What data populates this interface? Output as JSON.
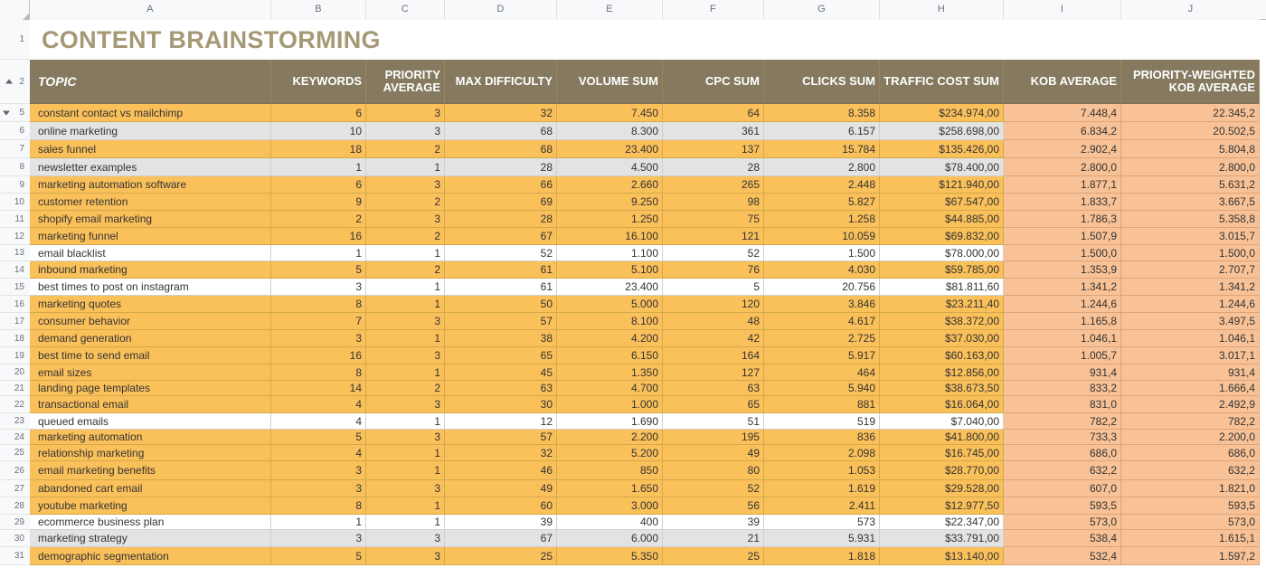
{
  "column_headers": [
    "A",
    "B",
    "C",
    "D",
    "E",
    "F",
    "G",
    "H",
    "I",
    "J"
  ],
  "title": "CONTENT BRAINSTORMING",
  "table_headers": {
    "a": "TOPIC",
    "b": "KEYWORDS",
    "c_line1": "PRIORITY",
    "c_line2": "AVERAGE",
    "d": "MAX DIFFICULTY",
    "e": "VOLUME SUM",
    "f": "CPC SUM",
    "g": "CLICKS SUM",
    "h": "TRAFFIC COST SUM",
    "i": "KOB AVERAGE",
    "j_line1": "PRIORITY-WEIGHTED",
    "j_line2": "KOB AVERAGE"
  },
  "colors": {
    "header_band": "#857a5f",
    "title_text": "#a59875",
    "fill_orange": "#fac05a",
    "fill_gray": "#e3e3e3",
    "fill_white": "#ffffff",
    "fill_peach": "#f8c296"
  },
  "icons": {
    "collapse_group_icon": "triangle-down",
    "expand_group_icon": "triangle-up",
    "scroll_left_icon": "triangle-left"
  },
  "rows": [
    {
      "num": "5",
      "fill": "orange",
      "topic": "constant contact vs mailchimp",
      "keywords": "6",
      "priority": "3",
      "maxdiff": "32",
      "volume": "7.450",
      "cpc": "64",
      "clicks": "8.358",
      "traffic": "$234.974,00",
      "kob": "7.448,4",
      "pwkob": "22.345,2"
    },
    {
      "num": "6",
      "fill": "gray",
      "topic": "online marketing",
      "keywords": "10",
      "priority": "3",
      "maxdiff": "68",
      "volume": "8.300",
      "cpc": "361",
      "clicks": "6.157",
      "traffic": "$258.698,00",
      "kob": "6.834,2",
      "pwkob": "20.502,5"
    },
    {
      "num": "7",
      "fill": "orange",
      "topic": "sales funnel",
      "keywords": "18",
      "priority": "2",
      "maxdiff": "68",
      "volume": "23.400",
      "cpc": "137",
      "clicks": "15.784",
      "traffic": "$135.426,00",
      "kob": "2.902,4",
      "pwkob": "5.804,8"
    },
    {
      "num": "8",
      "fill": "gray",
      "topic": "newsletter examples",
      "keywords": "1",
      "priority": "1",
      "maxdiff": "28",
      "volume": "4.500",
      "cpc": "28",
      "clicks": "2.800",
      "traffic": "$78.400,00",
      "kob": "2.800,0",
      "pwkob": "2.800,0"
    },
    {
      "num": "9",
      "fill": "orange",
      "topic": "marketing automation software",
      "keywords": "6",
      "priority": "3",
      "maxdiff": "66",
      "volume": "2.660",
      "cpc": "265",
      "clicks": "2.448",
      "traffic": "$121.940,00",
      "kob": "1.877,1",
      "pwkob": "5.631,2"
    },
    {
      "num": "10",
      "fill": "orange",
      "topic": "customer retention",
      "keywords": "9",
      "priority": "2",
      "maxdiff": "69",
      "volume": "9.250",
      "cpc": "98",
      "clicks": "5.827",
      "traffic": "$67.547,00",
      "kob": "1.833,7",
      "pwkob": "3.667,5"
    },
    {
      "num": "11",
      "fill": "orange",
      "topic": "shopify email marketing",
      "keywords": "2",
      "priority": "3",
      "maxdiff": "28",
      "volume": "1.250",
      "cpc": "75",
      "clicks": "1.258",
      "traffic": "$44.885,00",
      "kob": "1.786,3",
      "pwkob": "5.358,8"
    },
    {
      "num": "12",
      "fill": "orange",
      "topic": "marketing funnel",
      "keywords": "16",
      "priority": "2",
      "maxdiff": "67",
      "volume": "16.100",
      "cpc": "121",
      "clicks": "10.059",
      "traffic": "$69.832,00",
      "kob": "1.507,9",
      "pwkob": "3.015,7"
    },
    {
      "num": "13",
      "fill": "white",
      "topic": "email blacklist",
      "keywords": "1",
      "priority": "1",
      "maxdiff": "52",
      "volume": "1.100",
      "cpc": "52",
      "clicks": "1.500",
      "traffic": "$78.000,00",
      "kob": "1.500,0",
      "pwkob": "1.500,0"
    },
    {
      "num": "14",
      "fill": "orange",
      "topic": "inbound marketing",
      "keywords": "5",
      "priority": "2",
      "maxdiff": "61",
      "volume": "5.100",
      "cpc": "76",
      "clicks": "4.030",
      "traffic": "$59.785,00",
      "kob": "1.353,9",
      "pwkob": "2.707,7"
    },
    {
      "num": "15",
      "fill": "white",
      "topic": "best times to post on instagram",
      "keywords": "3",
      "priority": "1",
      "maxdiff": "61",
      "volume": "23.400",
      "cpc": "5",
      "clicks": "20.756",
      "traffic": "$81.811,60",
      "kob": "1.341,2",
      "pwkob": "1.341,2"
    },
    {
      "num": "16",
      "fill": "orange",
      "topic": "marketing quotes",
      "keywords": "8",
      "priority": "1",
      "maxdiff": "50",
      "volume": "5.000",
      "cpc": "120",
      "clicks": "3.846",
      "traffic": "$23.211,40",
      "kob": "1.244,6",
      "pwkob": "1.244,6"
    },
    {
      "num": "17",
      "fill": "orange",
      "topic": "consumer behavior",
      "keywords": "7",
      "priority": "3",
      "maxdiff": "57",
      "volume": "8.100",
      "cpc": "48",
      "clicks": "4.617",
      "traffic": "$38.372,00",
      "kob": "1.165,8",
      "pwkob": "3.497,5"
    },
    {
      "num": "18",
      "fill": "orange",
      "topic": "demand generation",
      "keywords": "3",
      "priority": "1",
      "maxdiff": "38",
      "volume": "4.200",
      "cpc": "42",
      "clicks": "2.725",
      "traffic": "$37.030,00",
      "kob": "1.046,1",
      "pwkob": "1.046,1"
    },
    {
      "num": "19",
      "fill": "orange",
      "topic": "best time to send email",
      "keywords": "16",
      "priority": "3",
      "maxdiff": "65",
      "volume": "6.150",
      "cpc": "164",
      "clicks": "5.917",
      "traffic": "$60.163,00",
      "kob": "1.005,7",
      "pwkob": "3.017,1"
    },
    {
      "num": "20",
      "fill": "orange",
      "topic": "email sizes",
      "keywords": "8",
      "priority": "1",
      "maxdiff": "45",
      "volume": "1.350",
      "cpc": "127",
      "clicks": "464",
      "traffic": "$12.856,00",
      "kob": "931,4",
      "pwkob": "931,4"
    },
    {
      "num": "21",
      "fill": "orange",
      "topic": "landing page templates",
      "keywords": "14",
      "priority": "2",
      "maxdiff": "63",
      "volume": "4.700",
      "cpc": "63",
      "clicks": "5.940",
      "traffic": "$38.673,50",
      "kob": "833,2",
      "pwkob": "1.666,4"
    },
    {
      "num": "22",
      "fill": "orange",
      "topic": "transactional email",
      "keywords": "4",
      "priority": "3",
      "maxdiff": "30",
      "volume": "1.000",
      "cpc": "65",
      "clicks": "881",
      "traffic": "$16.064,00",
      "kob": "831,0",
      "pwkob": "2.492,9"
    },
    {
      "num": "23",
      "fill": "white",
      "topic": "queued emails",
      "keywords": "4",
      "priority": "1",
      "maxdiff": "12",
      "volume": "1.690",
      "cpc": "51",
      "clicks": "519",
      "traffic": "$7.040,00",
      "kob": "782,2",
      "pwkob": "782,2"
    },
    {
      "num": "24",
      "fill": "orange",
      "topic": "marketing automation",
      "keywords": "5",
      "priority": "3",
      "maxdiff": "57",
      "volume": "2.200",
      "cpc": "195",
      "clicks": "836",
      "traffic": "$41.800,00",
      "kob": "733,3",
      "pwkob": "2.200,0"
    },
    {
      "num": "25",
      "fill": "orange",
      "topic": "relationship marketing",
      "keywords": "4",
      "priority": "1",
      "maxdiff": "32",
      "volume": "5.200",
      "cpc": "49",
      "clicks": "2.098",
      "traffic": "$16.745,00",
      "kob": "686,0",
      "pwkob": "686,0"
    },
    {
      "num": "26",
      "fill": "orange",
      "topic": "email marketing benefits",
      "keywords": "3",
      "priority": "1",
      "maxdiff": "46",
      "volume": "850",
      "cpc": "80",
      "clicks": "1.053",
      "traffic": "$28.770,00",
      "kob": "632,2",
      "pwkob": "632,2"
    },
    {
      "num": "27",
      "fill": "orange",
      "topic": "abandoned cart email",
      "keywords": "3",
      "priority": "3",
      "maxdiff": "49",
      "volume": "1.650",
      "cpc": "52",
      "clicks": "1.619",
      "traffic": "$29.528,00",
      "kob": "607,0",
      "pwkob": "1.821,0"
    },
    {
      "num": "28",
      "fill": "orange",
      "topic": "youtube marketing",
      "keywords": "8",
      "priority": "1",
      "maxdiff": "60",
      "volume": "3.000",
      "cpc": "56",
      "clicks": "2.411",
      "traffic": "$12.977,50",
      "kob": "593,5",
      "pwkob": "593,5"
    },
    {
      "num": "29",
      "fill": "white",
      "topic": "ecommerce business plan",
      "keywords": "1",
      "priority": "1",
      "maxdiff": "39",
      "volume": "400",
      "cpc": "39",
      "clicks": "573",
      "traffic": "$22.347,00",
      "kob": "573,0",
      "pwkob": "573,0"
    },
    {
      "num": "30",
      "fill": "gray",
      "topic": "marketing strategy",
      "keywords": "3",
      "priority": "3",
      "maxdiff": "67",
      "volume": "6.000",
      "cpc": "21",
      "clicks": "5.931",
      "traffic": "$33.791,00",
      "kob": "538,4",
      "pwkob": "1.615,1"
    },
    {
      "num": "31",
      "fill": "orange",
      "topic": "demographic segmentation",
      "keywords": "5",
      "priority": "3",
      "maxdiff": "25",
      "volume": "5.350",
      "cpc": "25",
      "clicks": "1.818",
      "traffic": "$13.140,00",
      "kob": "532,4",
      "pwkob": "1.597,2"
    }
  ]
}
